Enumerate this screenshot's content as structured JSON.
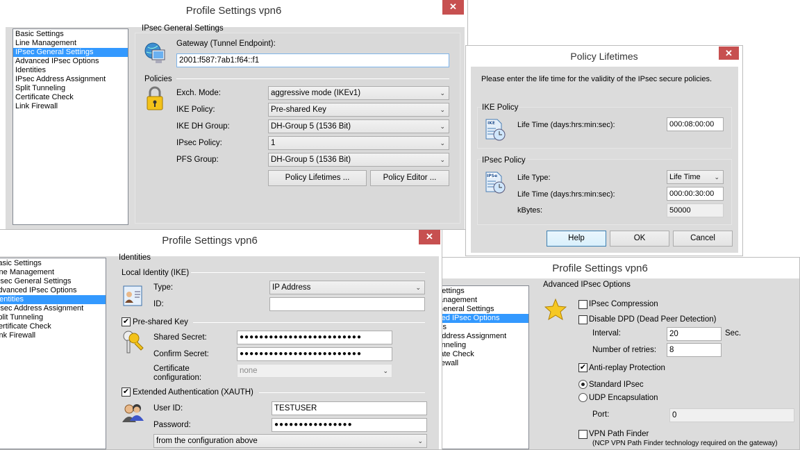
{
  "nav_items": [
    "Basic Settings",
    "Line Management",
    "IPsec General Settings",
    "Advanced IPsec Options",
    "Identities",
    "IPsec Address Assignment",
    "Split Tunneling",
    "Certificate Check",
    "Link Firewall"
  ],
  "general_window": {
    "title": "Profile Settings   vpn6",
    "close": "✕",
    "section": "IPsec General Settings",
    "gateway_label": "Gateway (Tunnel Endpoint):",
    "gateway_value": "2001:f587:7ab1:f64::f1",
    "policies_label": "Policies",
    "fields": [
      {
        "label": "Exch. Mode:",
        "value": "aggressive mode (IKEv1)"
      },
      {
        "label": "IKE Policy:",
        "value": "Pre-shared Key"
      },
      {
        "label": "IKE DH Group:",
        "value": "DH-Group 5 (1536 Bit)"
      },
      {
        "label": "IPsec Policy:",
        "value": "1"
      },
      {
        "label": "PFS Group:",
        "value": "DH-Group 5 (1536 Bit)"
      }
    ],
    "policy_lifetimes_button": "Policy Lifetimes ...",
    "policy_editor_button": "Policy Editor ..."
  },
  "lifetimes_window": {
    "title": "Policy Lifetimes",
    "close": "✕",
    "intro": "Please enter the life time for the validity of the IPsec secure policies.",
    "ike_group": "IKE Policy",
    "ike_icon_text": "IKE",
    "ike_lifetime_label": "Life Time (days:hrs:min:sec):",
    "ike_lifetime_value": "000:08:00:00",
    "ipsec_group": "IPsec Policy",
    "ipsec_icon_text": "IPSe",
    "life_type_label": "Life Type:",
    "life_type_value": "Life Time",
    "ipsec_lifetime_label": "Life Time (days:hrs:min:sec):",
    "ipsec_lifetime_value": "000:00:30:00",
    "kbytes_label": "kBytes:",
    "kbytes_value": "50000",
    "help": "Help",
    "ok": "OK",
    "cancel": "Cancel"
  },
  "identities_window": {
    "title": "Profile Settings   vpn6",
    "close": "✕",
    "section": "Identities",
    "local_identity": "Local Identity (IKE)",
    "type_label": "Type:",
    "type_value": "IP Address",
    "id_label": "ID:",
    "id_value": "",
    "psk_label": "Pre-shared Key",
    "psk_checked": true,
    "shared_secret_label": "Shared Secret:",
    "shared_secret_value": "●●●●●●●●●●●●●●●●●●●●●●●●●",
    "confirm_secret_label": "Confirm Secret:",
    "confirm_secret_value": "●●●●●●●●●●●●●●●●●●●●●●●●●",
    "cert_label_1": "Certificate",
    "cert_label_2": "configuration:",
    "cert_value": "none",
    "xauth_label": "Extended Authentication (XAUTH)",
    "xauth_checked": true,
    "user_id_label": "User ID:",
    "user_id_value": "TESTUSER",
    "password_label": "Password:",
    "password_value": "●●●●●●●●●●●●●●●●",
    "source_value": "from the configuration above"
  },
  "advanced_window": {
    "title": "Profile Settings   vpn6",
    "section": "Advanced IPsec Options",
    "ipsec_compression": "IPsec Compression",
    "disable_dpd": "Disable DPD (Dead Peer Detection)",
    "interval_label": "Interval:",
    "interval_value": "20",
    "interval_unit": "Sec.",
    "retries_label": "Number of retries:",
    "retries_value": "8",
    "anti_replay": "Anti-replay Protection",
    "standard_ipsec": "Standard IPsec",
    "udp_encapsulation": "UDP Encapsulation",
    "port_label": "Port:",
    "port_value": "0",
    "vpn_path_finder": "VPN Path Finder",
    "path_finder_note": "(NCP VPN Path Finder technology required on the gateway)"
  },
  "check_mark": "✔",
  "chevron": "⌄"
}
